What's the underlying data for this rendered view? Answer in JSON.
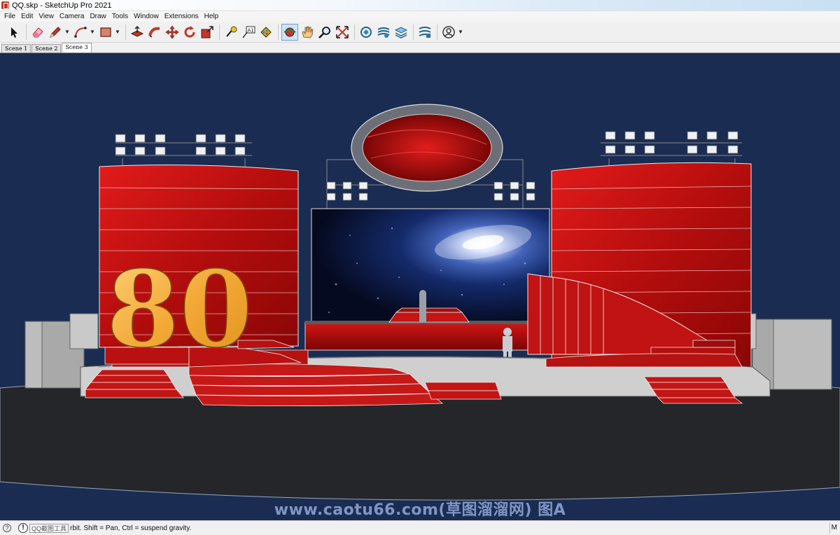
{
  "window": {
    "title": "QQ.skp - SketchUp Pro 2021"
  },
  "menu": {
    "items": [
      "File",
      "Edit",
      "View",
      "Camera",
      "Draw",
      "Tools",
      "Window",
      "Extensions",
      "Help"
    ]
  },
  "toolbar": {
    "tools": [
      {
        "name": "select-tool",
        "icon": "arrow-cursor-icon"
      },
      {
        "name": "eraser-tool",
        "icon": "eraser-icon"
      },
      {
        "name": "pencil-tool",
        "icon": "pencil-icon",
        "dropdown": true
      },
      {
        "name": "arc-tool",
        "icon": "arc-icon",
        "dropdown": true
      },
      {
        "name": "rectangle-tool",
        "icon": "rectangle-icon",
        "dropdown": true
      },
      {
        "name": "push-pull-tool",
        "icon": "push-pull-icon"
      },
      {
        "name": "follow-me-tool",
        "icon": "follow-me-icon"
      },
      {
        "name": "move-tool",
        "icon": "move-icon"
      },
      {
        "name": "rotate-tool",
        "icon": "rotate-icon"
      },
      {
        "name": "scale-tool",
        "icon": "scale-icon"
      },
      {
        "name": "tape-measure-tool",
        "icon": "tape-measure-icon"
      },
      {
        "name": "text-tool",
        "icon": "text-icon"
      },
      {
        "name": "paint-bucket-tool",
        "icon": "paint-bucket-icon"
      },
      {
        "name": "orbit-tool",
        "icon": "orbit-icon",
        "active": true
      },
      {
        "name": "pan-tool",
        "icon": "hand-icon"
      },
      {
        "name": "zoom-tool",
        "icon": "magnifier-icon"
      },
      {
        "name": "zoom-extents-tool",
        "icon": "zoom-extents-icon"
      },
      {
        "name": "3d-warehouse",
        "icon": "warehouse-icon"
      },
      {
        "name": "extension-warehouse",
        "icon": "extension-warehouse-icon"
      },
      {
        "name": "layout-send",
        "icon": "layers-icon"
      },
      {
        "name": "extension-manager",
        "icon": "extension-manager-icon"
      },
      {
        "name": "account",
        "icon": "user-circle-icon",
        "dropdown": true
      }
    ]
  },
  "scenes": {
    "tabs": [
      "Scene 1",
      "Scene 2",
      "Scene 3"
    ],
    "active": 2
  },
  "viewport": {
    "background": "#1b2c52",
    "anniversary_number": "80",
    "watermark": "www.caotu66.com(草图溜溜网) 图A"
  },
  "status": {
    "chip": "QQ截图工具",
    "message": "rbit. Shift = Pan, Ctrl = suspend gravity.",
    "right": "M"
  }
}
